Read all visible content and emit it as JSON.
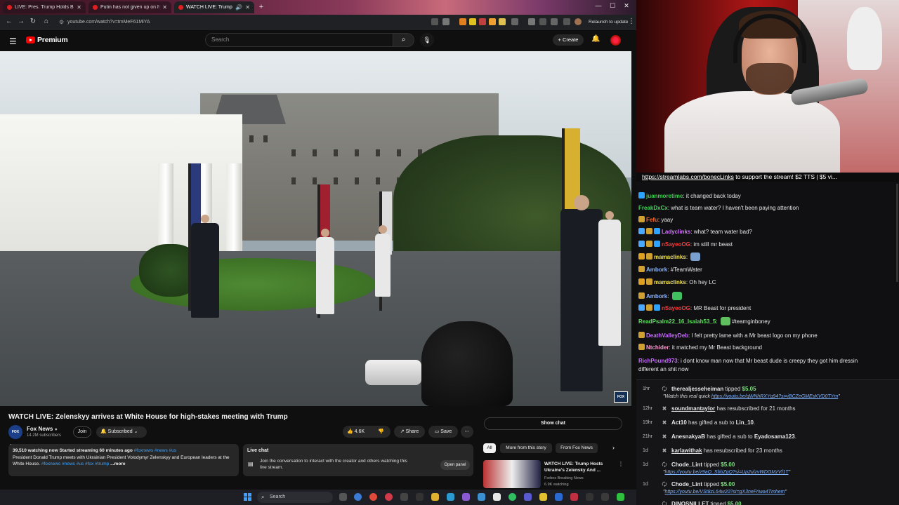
{
  "browser": {
    "tabs": [
      {
        "title": "LIVE: Pres. Trump Holds Bilate...",
        "active": false
      },
      {
        "title": "Putin has not given up on his ...",
        "active": false
      },
      {
        "title": "WATCH LIVE: Trump holds ...",
        "active": true
      }
    ],
    "url": "youtube.com/watch?v=tmMeF61MiYA",
    "relaunch_label": "Relaunch to update"
  },
  "youtube": {
    "logo_text": "Premium",
    "search_placeholder": "Search",
    "create_label": "Create",
    "video_title": "WATCH LIVE: Zelenskyy arrives at White House for high-stakes meeting with Trump",
    "channel": {
      "name": "Fox News",
      "subscribers": "14.2M subscribers",
      "logo_text": "FOX NEWS"
    },
    "join_label": "Join",
    "subscribed_label": "Subscribed",
    "likes": "4.6K",
    "share_label": "Share",
    "save_label": "Save",
    "description": {
      "meta": "39,510 watching now  Started streaming 60 minutes ago",
      "meta_tags": " #foxnews #news #us",
      "text": "President Donald Trump meets with Ukrainian President Volodymyr Zelenskyy and European leaders at the White House.",
      "tags": " #foxnews #news #us #fox #trump",
      "more": "...more"
    },
    "live_chat": {
      "title": "Live chat",
      "body": "Join the conversation to interact with the creator and others watching this live stream.",
      "open_panel": "Open panel"
    },
    "show_chat": "Show chat",
    "chips": [
      {
        "label": "All",
        "active": true
      },
      {
        "label": "More from this story",
        "active": false
      },
      {
        "label": "From Fox News",
        "active": false
      }
    ],
    "recommended": {
      "title": "WATCH LIVE: Trump Hosts Ukraine's Zelensky And ...",
      "channel": "Forbes Breaking News",
      "views": "6.9K watching"
    },
    "fox_bug": "FOX"
  },
  "taskbar": {
    "search_label": "Search"
  },
  "stream": {
    "marquee_link": "https://streamlabs.com/bonecLinks",
    "marquee_rest": " to support the stream! $2 TTS | $5 vi..."
  },
  "chat": [
    {
      "user": "juanmoretime",
      "color": "#3ccf4e",
      "text": "it changed back today",
      "badges": [
        "#2ba3ff"
      ]
    },
    {
      "user": "FreakDxCx",
      "color": "#44d25a",
      "text": "what is team water? I haven't been paying attention",
      "badges": []
    },
    {
      "user": "Fefu",
      "color": "#ff6a2b",
      "text": "yaay",
      "badges": [
        "#d0a030"
      ]
    },
    {
      "user": "Ladyclinks",
      "color": "#d773ff",
      "text": "what? team water bad?",
      "badges": [
        "#4aa8ff",
        "#d0a030",
        "#2ba3ff"
      ]
    },
    {
      "user": "nSayeoOG",
      "color": "#ff3a3a",
      "text": "im still mr beast",
      "badges": [
        "#4aa8ff",
        "#d0a030",
        "#2ba3ff"
      ]
    },
    {
      "user": "mamaclinks",
      "color": "#f0e050",
      "text": "",
      "badges": [
        "#e0a020",
        "#d0a030"
      ],
      "emote": "#7aa0d0"
    },
    {
      "user": "Ambork",
      "color": "#8ab4ff",
      "text": "#TeamWater",
      "badges": [
        "#d0a030"
      ]
    },
    {
      "user": "mamaclinks",
      "color": "#f0e050",
      "text": "Oh hey LC",
      "badges": [
        "#e0a020",
        "#d0a030"
      ]
    },
    {
      "user": "Ambork",
      "color": "#8ab4ff",
      "text": "",
      "badges": [
        "#d0a030"
      ],
      "emote": "#40c060"
    },
    {
      "user": "nSayeoOG",
      "color": "#ff3a3a",
      "text": "MR Beast for president",
      "badges": [
        "#4aa8ff",
        "#d0a030",
        "#2ba3ff"
      ]
    },
    {
      "user": "ReadPsalm22_16_Isaiah53_5",
      "color": "#59e05a",
      "text": "#teamginboney",
      "badges": [],
      "emote": "#60c060"
    },
    {
      "user": "DeathValleyDeb",
      "color": "#c76cff",
      "text": "I felt pretty lame with a Mr beast logo on my phone",
      "badges": [
        "#d0a030"
      ]
    },
    {
      "user": "Ntchider",
      "color": "#ff9ad0",
      "text": "it matched my Mr Beast background",
      "badges": [
        "#d0a030"
      ]
    },
    {
      "user": "RichPound973",
      "color": "#c76cff",
      "text": "i dont know man now that Mr beast dude is creepy they got him dressin",
      "badges": []
    },
    {
      "user": "",
      "color": "#e8e8e8",
      "text": "different an shit now",
      "badges": []
    }
  ],
  "events": [
    {
      "time": "1hr",
      "icon": "tip-icon",
      "name": "therealjesseheiman",
      "action": " tipped ",
      "amount": "$5.05",
      "sub": "\"Watch this real quick ",
      "sub_link": "https://youtu.be/qWNhRXYg94?si=iBCZeGMEsKVD0TYm",
      "sub_end": "\""
    },
    {
      "time": "12hr",
      "icon": "sub-icon",
      "name": "soundmantaylor",
      "action": " has resubscribed for 21 months",
      "underline": true
    },
    {
      "time": "19hr",
      "icon": "sub-icon",
      "name": "Act10",
      "action": " has gifted a sub to ",
      "target": "Lin_10",
      "tail": "."
    },
    {
      "time": "21hr",
      "icon": "sub-icon",
      "name": "AnesnakyaB",
      "action": " has gifted a sub to ",
      "target": "Eyadosama123",
      "tail": "."
    },
    {
      "time": "1d",
      "icon": "sub-icon",
      "name": "karlawithak",
      "action": " has resubscribed for 23 months",
      "underline": true
    },
    {
      "time": "1d",
      "icon": "tip-icon",
      "name": "Chode_Lint",
      "action": " tipped ",
      "amount": "$5.00",
      "sub": "\"",
      "sub_link": "https://youtu.be/z9aQ_SbbZgQ?si=Up2ulzvWDGMzVf1T",
      "sub_end": "\""
    },
    {
      "time": "1d",
      "icon": "tip-icon",
      "name": "Chode_Lint",
      "action": " tipped ",
      "amount": "$5.00",
      "sub": "\"",
      "sub_link": "https://youtu.be/VSt8zL64w20?si=gX3neFriwa4Tmhem",
      "sub_end": "\""
    },
    {
      "time": "",
      "icon": "tip-icon",
      "name": "DINOSNILLET",
      "action": " tipped ",
      "amount": "$5.00",
      "sub": "",
      "sub_link": "",
      "sub_end": ""
    }
  ]
}
